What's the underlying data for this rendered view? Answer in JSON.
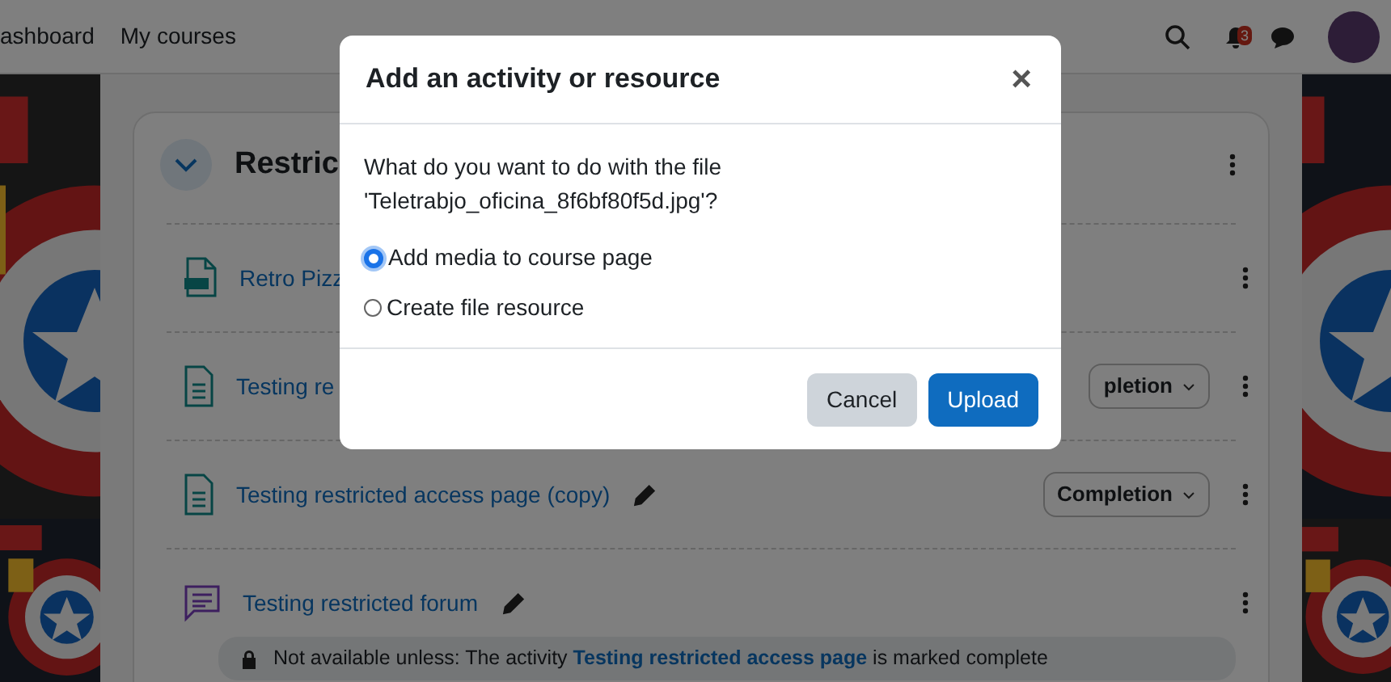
{
  "navbar": {
    "links": [
      "ashboard",
      "My courses"
    ],
    "notification_count": "3"
  },
  "section": {
    "title": "Restric",
    "expanded": true
  },
  "activities": [
    {
      "kind": "pdf",
      "title": "Retro Pizz"
    },
    {
      "kind": "page",
      "title": "Testing re",
      "completion": "pletion"
    },
    {
      "kind": "page",
      "title": "Testing restricted access page (copy)",
      "completion": "Completion",
      "editable": true
    },
    {
      "kind": "forum",
      "title": "Testing restricted forum",
      "editable": true,
      "restriction": {
        "before": "Not available unless: The activity ",
        "link": "Testing restricted access page",
        "after": " is marked complete"
      }
    }
  ],
  "modal": {
    "title": "Add an activity or resource",
    "close": "×",
    "question": "What do you want to do with the file 'Teletrabjo_oficina_8f6bf80f5d.jpg'?",
    "options": [
      {
        "label": "Add media to course page",
        "selected": true
      },
      {
        "label": "Create file resource",
        "selected": false
      }
    ],
    "buttons": [
      {
        "label": "Cancel",
        "kind": "secondary"
      },
      {
        "label": "Upload",
        "kind": "primary"
      }
    ]
  }
}
